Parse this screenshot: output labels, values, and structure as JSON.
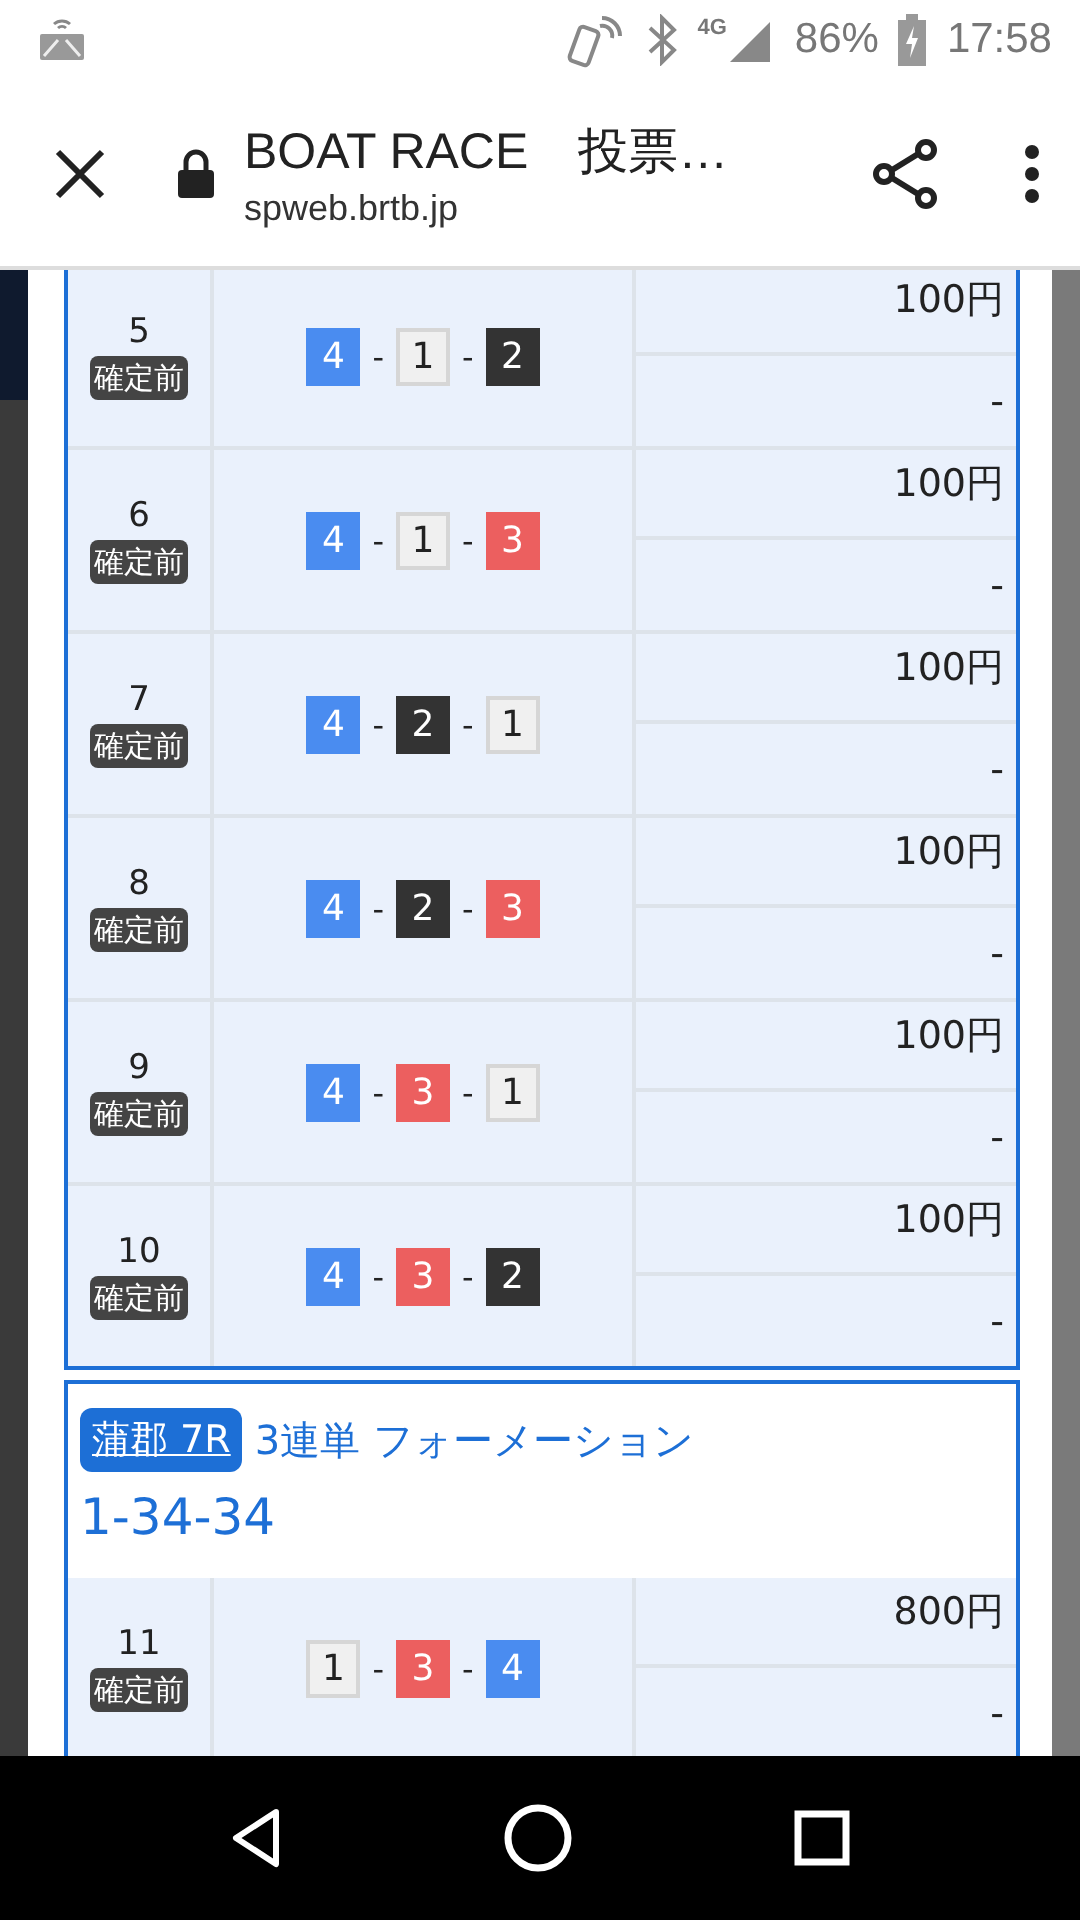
{
  "status_bar": {
    "network": "4G",
    "battery": "86%",
    "time": "17:58"
  },
  "toolbar": {
    "title": "BOAT RACE　投票…",
    "url": "spweb.brtb.jp"
  },
  "cards": [
    {
      "rows": [
        {
          "number": "5",
          "status": "確定前",
          "separator": "-",
          "boats": [
            {
              "number": "4",
              "color": "#4a8cf0"
            },
            {
              "number": "1",
              "color": "#f0f0f0"
            },
            {
              "number": "2",
              "color": "#333333"
            }
          ],
          "amount": "100円",
          "payout": "-"
        },
        {
          "number": "6",
          "status": "確定前",
          "separator": "-",
          "boats": [
            {
              "number": "4",
              "color": "#4a8cf0"
            },
            {
              "number": "1",
              "color": "#f0f0f0"
            },
            {
              "number": "3",
              "color": "#ec5f5f"
            }
          ],
          "amount": "100円",
          "payout": "-"
        },
        {
          "number": "7",
          "status": "確定前",
          "separator": "-",
          "boats": [
            {
              "number": "4",
              "color": "#4a8cf0"
            },
            {
              "number": "2",
              "color": "#333333"
            },
            {
              "number": "1",
              "color": "#f0f0f0"
            }
          ],
          "amount": "100円",
          "payout": "-"
        },
        {
          "number": "8",
          "status": "確定前",
          "separator": "-",
          "boats": [
            {
              "number": "4",
              "color": "#4a8cf0"
            },
            {
              "number": "2",
              "color": "#333333"
            },
            {
              "number": "3",
              "color": "#ec5f5f"
            }
          ],
          "amount": "100円",
          "payout": "-"
        },
        {
          "number": "9",
          "status": "確定前",
          "separator": "-",
          "boats": [
            {
              "number": "4",
              "color": "#4a8cf0"
            },
            {
              "number": "3",
              "color": "#ec5f5f"
            },
            {
              "number": "1",
              "color": "#f0f0f0"
            }
          ],
          "amount": "100円",
          "payout": "-"
        },
        {
          "number": "10",
          "status": "確定前",
          "separator": "-",
          "boats": [
            {
              "number": "4",
              "color": "#4a8cf0"
            },
            {
              "number": "3",
              "color": "#ec5f5f"
            },
            {
              "number": "2",
              "color": "#333333"
            }
          ],
          "amount": "100円",
          "payout": "-"
        }
      ]
    },
    {
      "venue": "蒲郡 7R",
      "bet_type": "3連単 フォーメーション",
      "combination": "1-34-34",
      "rows": [
        {
          "number": "11",
          "status": "確定前",
          "separator": "-",
          "boats": [
            {
              "number": "1",
              "color": "#f0f0f0"
            },
            {
              "number": "3",
              "color": "#ec5f5f"
            },
            {
              "number": "4",
              "color": "#4a8cf0"
            }
          ],
          "amount": "800円",
          "payout": "-"
        }
      ]
    }
  ]
}
